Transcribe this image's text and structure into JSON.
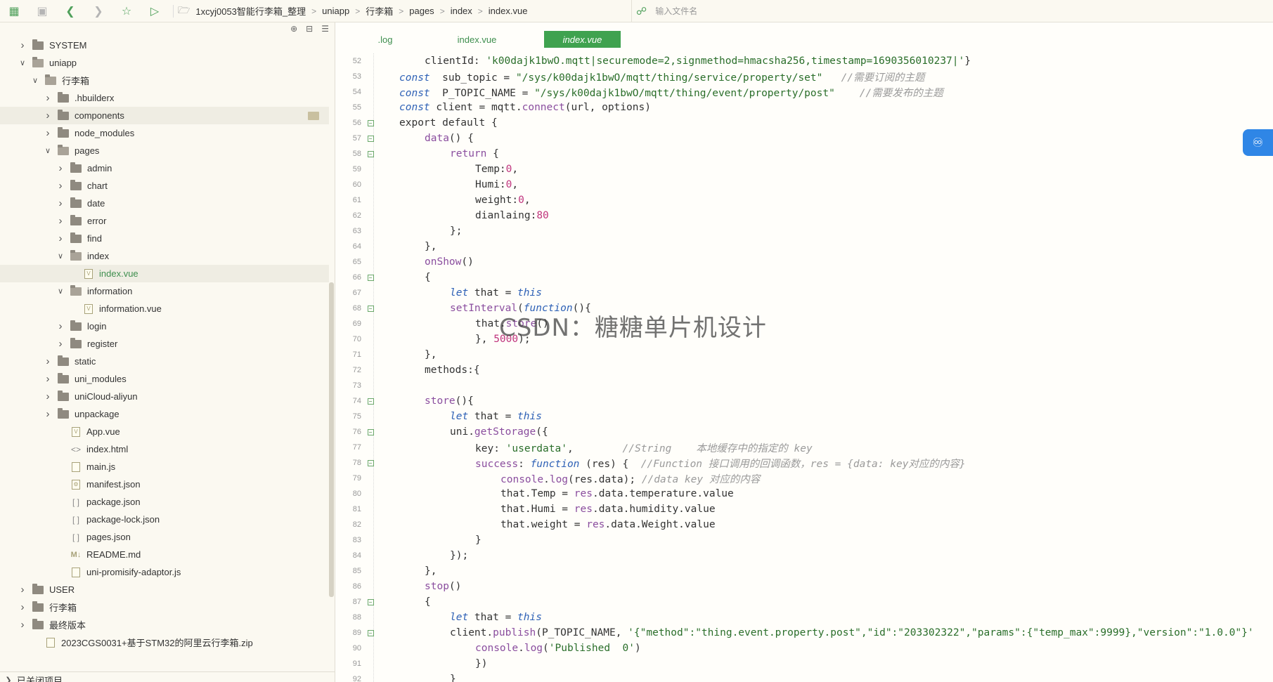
{
  "toolbar": {
    "icons": [
      "new-file-icon",
      "save-icon",
      "back-icon",
      "forward-icon",
      "star-icon",
      "run-icon"
    ],
    "breadcrumbs": [
      "1xcyj0053智能行李箱_整理",
      "uniapp",
      "行李箱",
      "pages",
      "index",
      "index.vue"
    ],
    "file_search_placeholder": "输入文件名"
  },
  "sidebar": {
    "closed_projects": "已关闭项目",
    "tree": [
      {
        "label": "SYSTEM",
        "type": "folder",
        "depth": 0,
        "state": "collapsed"
      },
      {
        "label": "uniapp",
        "type": "folder",
        "depth": 0,
        "state": "expanded"
      },
      {
        "label": "行李箱",
        "type": "folder",
        "depth": 1,
        "state": "expanded"
      },
      {
        "label": ".hbuilderx",
        "type": "folder",
        "depth": 2,
        "state": "collapsed"
      },
      {
        "label": "components",
        "type": "folder",
        "depth": 2,
        "state": "collapsed",
        "selected": true
      },
      {
        "label": "node_modules",
        "type": "folder",
        "depth": 2,
        "state": "collapsed"
      },
      {
        "label": "pages",
        "type": "folder",
        "depth": 2,
        "state": "expanded"
      },
      {
        "label": "admin",
        "type": "folder",
        "depth": 3,
        "state": "collapsed"
      },
      {
        "label": "chart",
        "type": "folder",
        "depth": 3,
        "state": "collapsed"
      },
      {
        "label": "date",
        "type": "folder",
        "depth": 3,
        "state": "collapsed"
      },
      {
        "label": "error",
        "type": "folder",
        "depth": 3,
        "state": "collapsed"
      },
      {
        "label": "find",
        "type": "folder",
        "depth": 3,
        "state": "collapsed"
      },
      {
        "label": "index",
        "type": "folder",
        "depth": 3,
        "state": "expanded"
      },
      {
        "label": "index.vue",
        "type": "vue",
        "depth": 4,
        "active": true
      },
      {
        "label": "information",
        "type": "folder",
        "depth": 3,
        "state": "expanded"
      },
      {
        "label": "information.vue",
        "type": "vue",
        "depth": 4
      },
      {
        "label": "login",
        "type": "folder",
        "depth": 3,
        "state": "collapsed"
      },
      {
        "label": "register",
        "type": "folder",
        "depth": 3,
        "state": "collapsed"
      },
      {
        "label": "static",
        "type": "folder",
        "depth": 2,
        "state": "collapsed"
      },
      {
        "label": "uni_modules",
        "type": "folder",
        "depth": 2,
        "state": "collapsed"
      },
      {
        "label": "uniCloud-aliyun",
        "type": "folder",
        "depth": 2,
        "state": "collapsed"
      },
      {
        "label": "unpackage",
        "type": "folder",
        "depth": 2,
        "state": "collapsed"
      },
      {
        "label": "App.vue",
        "type": "vue",
        "depth": 3
      },
      {
        "label": "index.html",
        "type": "html",
        "depth": 3
      },
      {
        "label": "main.js",
        "type": "js",
        "depth": 3
      },
      {
        "label": "manifest.json",
        "type": "manifest",
        "depth": 3
      },
      {
        "label": "package.json",
        "type": "json",
        "depth": 3
      },
      {
        "label": "package-lock.json",
        "type": "json",
        "depth": 3
      },
      {
        "label": "pages.json",
        "type": "json",
        "depth": 3
      },
      {
        "label": "README.md",
        "type": "md",
        "depth": 3
      },
      {
        "label": "uni-promisify-adaptor.js",
        "type": "js",
        "depth": 3
      },
      {
        "label": "USER",
        "type": "folder",
        "depth": 0,
        "state": "collapsed"
      },
      {
        "label": "行李箱",
        "type": "folder",
        "depth": 0,
        "state": "collapsed"
      },
      {
        "label": "最终版本",
        "type": "folder",
        "depth": 0,
        "state": "collapsed"
      },
      {
        "label": "2023CGS0031+基于STM32的阿里云行李箱.zip",
        "type": "zip",
        "depth": 1
      }
    ]
  },
  "tabs": [
    {
      "label": ".log",
      "active": false
    },
    {
      "label": "index.vue",
      "active": false
    },
    {
      "label": "index.vue",
      "active": true
    }
  ],
  "editor": {
    "lines": [
      {
        "n": "52",
        "fold": false,
        "indent": 1,
        "tokens": [
          [
            "id",
            "clientId: "
          ],
          [
            "str",
            "'k00dajk1bwO.mqtt|securemode=2,signmethod=hmacsha256,timestamp=1690356010237|'"
          ],
          [
            "id",
            "}"
          ]
        ]
      },
      {
        "n": "53",
        "fold": false,
        "indent": 0,
        "tokens": [
          [
            "kw",
            "const"
          ],
          [
            "id",
            "  sub_topic = "
          ],
          [
            "str",
            "\"/sys/k00dajk1bwO/mqtt/thing/service/property/set\""
          ],
          [
            "id",
            "   "
          ],
          [
            "cm",
            "//需要订阅的主题"
          ]
        ]
      },
      {
        "n": "54",
        "fold": false,
        "indent": 0,
        "tokens": [
          [
            "kw",
            "const"
          ],
          [
            "id",
            "  P_TOPIC_NAME = "
          ],
          [
            "str",
            "\"/sys/k00dajk1bwO/mqtt/thing/event/property/post\""
          ],
          [
            "id",
            "    "
          ],
          [
            "cm",
            "//需要发布的主题"
          ]
        ]
      },
      {
        "n": "55",
        "fold": false,
        "indent": 0,
        "tokens": [
          [
            "kw",
            "const"
          ],
          [
            "id",
            " client = mqtt."
          ],
          [
            "fn",
            "connect"
          ],
          [
            "id",
            "(url, options)"
          ]
        ]
      },
      {
        "n": "56",
        "fold": true,
        "indent": 0,
        "tokens": [
          [
            "id",
            "export default {"
          ]
        ]
      },
      {
        "n": "57",
        "fold": true,
        "indent": 1,
        "tokens": [
          [
            "fn",
            "data"
          ],
          [
            "id",
            "() {"
          ]
        ]
      },
      {
        "n": "58",
        "fold": true,
        "indent": 2,
        "tokens": [
          [
            "fn",
            "return"
          ],
          [
            "id",
            " {"
          ]
        ]
      },
      {
        "n": "59",
        "fold": false,
        "indent": 3,
        "tokens": [
          [
            "id",
            "Temp:"
          ],
          [
            "num",
            "0"
          ],
          [
            "id",
            ","
          ]
        ]
      },
      {
        "n": "60",
        "fold": false,
        "indent": 3,
        "tokens": [
          [
            "id",
            "Humi:"
          ],
          [
            "num",
            "0"
          ],
          [
            "id",
            ","
          ]
        ]
      },
      {
        "n": "61",
        "fold": false,
        "indent": 3,
        "tokens": [
          [
            "id",
            "weight:"
          ],
          [
            "num",
            "0"
          ],
          [
            "id",
            ","
          ]
        ]
      },
      {
        "n": "62",
        "fold": false,
        "indent": 3,
        "tokens": [
          [
            "id",
            "dianlaing:"
          ],
          [
            "num",
            "80"
          ]
        ]
      },
      {
        "n": "63",
        "fold": false,
        "indent": 2,
        "tokens": [
          [
            "id",
            "};"
          ]
        ]
      },
      {
        "n": "64",
        "fold": false,
        "indent": 1,
        "tokens": [
          [
            "id",
            "},"
          ]
        ]
      },
      {
        "n": "65",
        "fold": false,
        "indent": 1,
        "tokens": [
          [
            "fn",
            "onShow"
          ],
          [
            "id",
            "()"
          ]
        ]
      },
      {
        "n": "66",
        "fold": true,
        "indent": 1,
        "tokens": [
          [
            "id",
            "{"
          ]
        ]
      },
      {
        "n": "67",
        "fold": false,
        "indent": 2,
        "tokens": [
          [
            "kw",
            "let"
          ],
          [
            "id",
            " that = "
          ],
          [
            "kw",
            "this"
          ]
        ]
      },
      {
        "n": "68",
        "fold": true,
        "indent": 2,
        "tokens": [
          [
            "fn",
            "setInterval"
          ],
          [
            "id",
            "("
          ],
          [
            "kw",
            "function"
          ],
          [
            "id",
            "(){"
          ]
        ]
      },
      {
        "n": "69",
        "fold": false,
        "indent": 3,
        "tokens": [
          [
            "id",
            "that."
          ],
          [
            "fn",
            "store"
          ],
          [
            "id",
            "()"
          ]
        ]
      },
      {
        "n": "70",
        "fold": false,
        "indent": 3,
        "tokens": [
          [
            "id",
            "}, "
          ],
          [
            "num",
            "5000"
          ],
          [
            "id",
            ");"
          ]
        ]
      },
      {
        "n": "71",
        "fold": false,
        "indent": 1,
        "tokens": [
          [
            "id",
            "},"
          ]
        ]
      },
      {
        "n": "72",
        "fold": false,
        "indent": 1,
        "tokens": [
          [
            "id",
            "methods:{"
          ]
        ]
      },
      {
        "n": "73",
        "fold": false,
        "indent": 0,
        "tokens": []
      },
      {
        "n": "74",
        "fold": true,
        "indent": 1,
        "tokens": [
          [
            "fn",
            "store"
          ],
          [
            "id",
            "(){"
          ]
        ]
      },
      {
        "n": "75",
        "fold": false,
        "indent": 2,
        "tokens": [
          [
            "kw",
            "let"
          ],
          [
            "id",
            " that = "
          ],
          [
            "kw",
            "this"
          ]
        ]
      },
      {
        "n": "76",
        "fold": true,
        "indent": 2,
        "tokens": [
          [
            "id",
            "uni."
          ],
          [
            "fn",
            "getStorage"
          ],
          [
            "id",
            "({"
          ]
        ]
      },
      {
        "n": "77",
        "fold": false,
        "indent": 3,
        "tokens": [
          [
            "id",
            "key: "
          ],
          [
            "str",
            "'userdata'"
          ],
          [
            "id",
            ",        "
          ],
          [
            "cm",
            "//String    本地缓存中的指定的 key"
          ]
        ]
      },
      {
        "n": "78",
        "fold": true,
        "indent": 3,
        "tokens": [
          [
            "fn",
            "success"
          ],
          [
            "id",
            ": "
          ],
          [
            "kw",
            "function"
          ],
          [
            "id",
            " (res) {  "
          ],
          [
            "cm",
            "//Function 接口调用的回调函数，res = {data: key对应的内容}"
          ]
        ]
      },
      {
        "n": "79",
        "fold": false,
        "indent": 4,
        "tokens": [
          [
            "fn",
            "console"
          ],
          [
            "id",
            "."
          ],
          [
            "fn",
            "log"
          ],
          [
            "id",
            "(res.data); "
          ],
          [
            "cm",
            "//data key 对应的内容"
          ]
        ]
      },
      {
        "n": "80",
        "fold": false,
        "indent": 4,
        "tokens": [
          [
            "id",
            "that.Temp = "
          ],
          [
            "fn",
            "res"
          ],
          [
            "id",
            ".data.temperature.value"
          ]
        ]
      },
      {
        "n": "81",
        "fold": false,
        "indent": 4,
        "tokens": [
          [
            "id",
            "that.Humi = "
          ],
          [
            "fn",
            "res"
          ],
          [
            "id",
            ".data.humidity.value"
          ]
        ]
      },
      {
        "n": "82",
        "fold": false,
        "indent": 4,
        "tokens": [
          [
            "id",
            "that.weight = "
          ],
          [
            "fn",
            "res"
          ],
          [
            "id",
            ".data.Weight.value"
          ]
        ]
      },
      {
        "n": "83",
        "fold": false,
        "indent": 3,
        "tokens": [
          [
            "id",
            "}"
          ]
        ]
      },
      {
        "n": "84",
        "fold": false,
        "indent": 2,
        "tokens": [
          [
            "id",
            "});"
          ]
        ]
      },
      {
        "n": "85",
        "fold": false,
        "indent": 1,
        "tokens": [
          [
            "id",
            "},"
          ]
        ]
      },
      {
        "n": "86",
        "fold": false,
        "indent": 1,
        "tokens": [
          [
            "fn",
            "stop"
          ],
          [
            "id",
            "()"
          ]
        ]
      },
      {
        "n": "87",
        "fold": true,
        "indent": 1,
        "tokens": [
          [
            "id",
            "{"
          ]
        ]
      },
      {
        "n": "88",
        "fold": false,
        "indent": 2,
        "tokens": [
          [
            "kw",
            "let"
          ],
          [
            "id",
            " that = "
          ],
          [
            "kw",
            "this"
          ]
        ]
      },
      {
        "n": "89",
        "fold": true,
        "indent": 2,
        "tokens": [
          [
            "id",
            "client."
          ],
          [
            "fn",
            "publish"
          ],
          [
            "id",
            "(P_TOPIC_NAME, "
          ],
          [
            "str",
            "'{\"method\":\"thing.event.property.post\",\"id\":\"203302322\",\"params\":{\"temp_max\":9999},\"version\":\"1.0.0\"}'"
          ]
        ]
      },
      {
        "n": "90",
        "fold": false,
        "indent": 3,
        "tokens": [
          [
            "fn",
            "console"
          ],
          [
            "id",
            "."
          ],
          [
            "fn",
            "log"
          ],
          [
            "id",
            "("
          ],
          [
            "str",
            "'Published  0'"
          ],
          [
            "id",
            ")"
          ]
        ]
      },
      {
        "n": "91",
        "fold": false,
        "indent": 3,
        "tokens": [
          [
            "id",
            "})"
          ]
        ]
      },
      {
        "n": "92",
        "fold": false,
        "indent": 2,
        "tokens": [
          [
            "id",
            "}"
          ]
        ]
      }
    ]
  },
  "watermark": "CSDN：糖糖单片机设计"
}
